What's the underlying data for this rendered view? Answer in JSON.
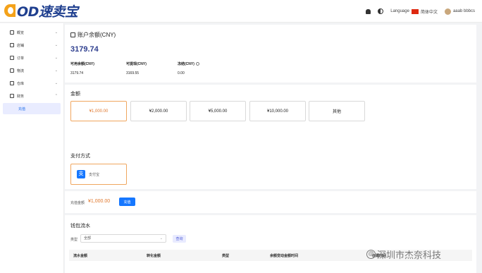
{
  "header": {
    "logo_text": "OD速卖宝",
    "language": "Language",
    "language_value": "简体中文",
    "username": "aaab bbbcs"
  },
  "sidebar": {
    "items": [
      {
        "label": "概览",
        "icon": "dashboard-icon"
      },
      {
        "label": "店铺",
        "icon": "store-icon"
      },
      {
        "label": "订单",
        "icon": "order-icon"
      },
      {
        "label": "物流",
        "icon": "truck-icon"
      },
      {
        "label": "仓库",
        "icon": "warehouse-icon"
      },
      {
        "label": "财务",
        "icon": "finance-icon"
      }
    ],
    "active_sub": "充值"
  },
  "balance": {
    "title": "账户余额(CNY)",
    "value": "3179.74",
    "available_label": "可用余额(CNY)",
    "available_value": "3179.74",
    "withdrawable_label": "可提现(CNY)",
    "withdrawable_value": "3169.55",
    "frozen_label": "冻结(CNY)",
    "frozen_value": "0.00"
  },
  "amount": {
    "title": "金额",
    "options": [
      "¥1,000.00",
      "¥2,000.00",
      "¥5,000.00",
      "¥10,000.00",
      "其他"
    ],
    "selected_index": 0
  },
  "payment": {
    "title": "支付方式",
    "method_label": "支付宝",
    "alipay_glyph": "支"
  },
  "recharge": {
    "label": "充值金额",
    "value": "¥1,000.00",
    "button": "充值"
  },
  "wallet_flow": {
    "title": "钱包流水",
    "filter_label": "类型",
    "filter_value": "全部",
    "query_button": "查询",
    "columns": [
      "流水金额",
      "转化金额",
      "类型",
      "余额变动金额时间",
      "创建时间"
    ]
  },
  "watermark": {
    "text": "深圳市杰奈科技",
    "glyph": "@"
  },
  "colors": {
    "accent_orange": "#e0782e",
    "brand_blue": "#1f3f8f",
    "primary_button": "#1677ff"
  }
}
